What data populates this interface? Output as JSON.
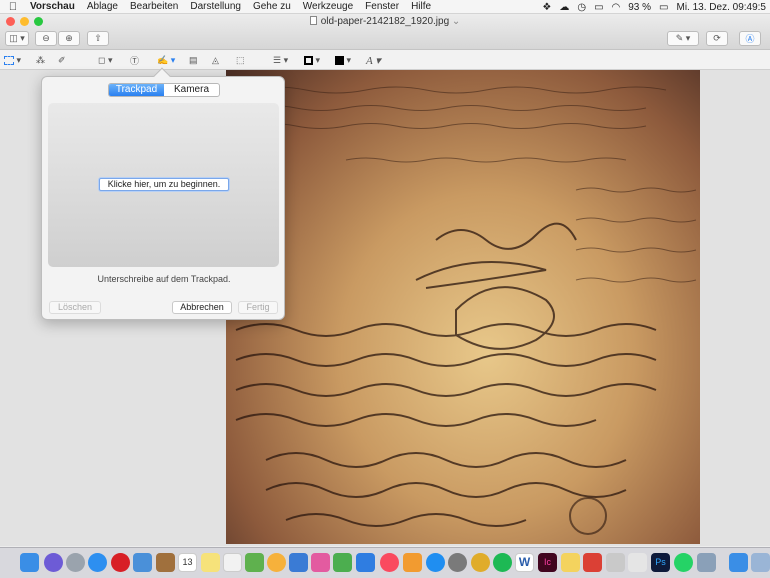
{
  "menubar": {
    "apple": "",
    "items": [
      "Vorschau",
      "Ablage",
      "Bearbeiten",
      "Darstellung",
      "Gehe zu",
      "Werkzeuge",
      "Fenster",
      "Hilfe"
    ],
    "battery": "93 %",
    "clock": "Mi. 13. Dez.  09:49:5"
  },
  "window": {
    "title": "old-paper-2142182_1920.jpg",
    "title_chevron": "⌄"
  },
  "signature": {
    "tabs": [
      "Trackpad",
      "Kamera"
    ],
    "active_tab": "Trackpad",
    "start_button": "Klicke hier, um zu beginnen.",
    "hint": "Unterschreibe auf dem Trackpad.",
    "clear_button": "Löschen",
    "cancel_button": "Abbrechen",
    "done_button": "Fertig"
  },
  "colors": {
    "accent": "#2a80f0",
    "close": "#fd5f57",
    "minimize": "#febc2e",
    "zoom": "#28c840"
  },
  "dock": {
    "calendar_day": "13"
  }
}
